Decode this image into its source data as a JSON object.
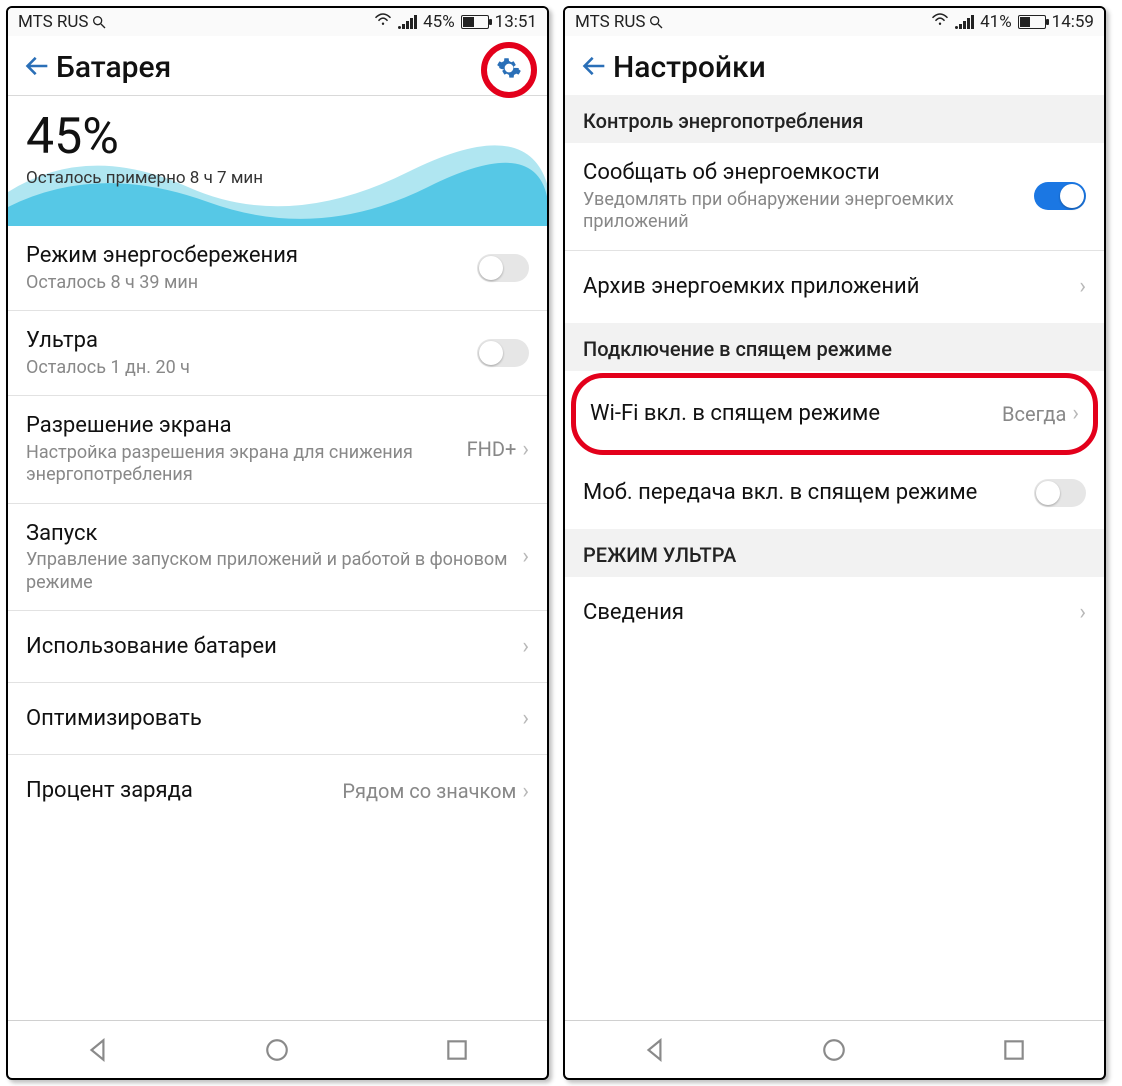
{
  "left": {
    "status": {
      "carrier": "MTS RUS",
      "battery_pct": "45%",
      "time": "13:51"
    },
    "header": {
      "title": "Батарея"
    },
    "hero": {
      "pct": "45%",
      "sub": "Осталось примерно 8 ч 7 мин"
    },
    "rows": {
      "power_save": {
        "title": "Режим энергосбережения",
        "sub": "Осталось 8 ч 39 мин"
      },
      "ultra": {
        "title": "Ультра",
        "sub": "Осталось 1 дн. 20 ч"
      },
      "resolution": {
        "title": "Разрешение экрана",
        "sub": "Настройка разрешения экрана для снижения энергопотребления",
        "value": "FHD+"
      },
      "launch": {
        "title": "Запуск",
        "sub": "Управление запуском приложений и работой в фоновом режиме"
      },
      "usage": {
        "title": "Использование батареи"
      },
      "optimize": {
        "title": "Оптимизировать"
      },
      "percent": {
        "title": "Процент заряда",
        "value": "Рядом со значком"
      }
    }
  },
  "right": {
    "status": {
      "carrier": "MTS RUS",
      "battery_pct": "41%",
      "time": "14:59"
    },
    "header": {
      "title": "Настройки"
    },
    "sections": {
      "power_control": "Контроль энергопотребления",
      "sleep_conn": "Подключение в спящем режиме",
      "ultra_mode": "РЕЖИМ УЛЬТРА"
    },
    "rows": {
      "notify": {
        "title": "Сообщать об энергоемкости",
        "sub": "Уведомлять при обнаружении энергоемких приложений"
      },
      "archive": {
        "title": "Архив энергоемких приложений"
      },
      "wifi_sleep": {
        "title": "Wi-Fi вкл. в спящем режиме",
        "value": "Всегда"
      },
      "mobile_sleep": {
        "title": "Моб. передача вкл. в спящем режиме"
      },
      "info": {
        "title": "Сведения"
      }
    }
  }
}
